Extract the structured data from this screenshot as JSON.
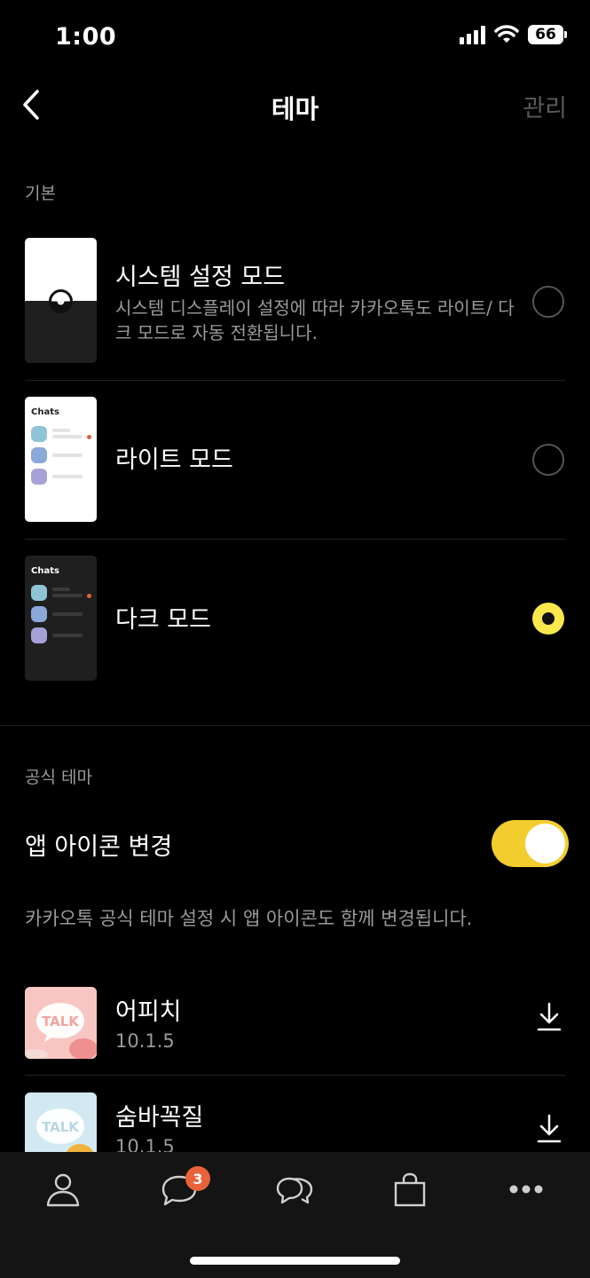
{
  "status": {
    "time": "1:00",
    "battery": "66"
  },
  "header": {
    "title": "테마",
    "manage": "관리"
  },
  "sections": {
    "basic": "기본",
    "official": "공식 테마"
  },
  "modes": [
    {
      "title": "시스템 설정 모드",
      "desc": "시스템 디스플레이 설정에 따라 카카오톡도 라이트/ 다크 모드로 자동 전환됩니다.",
      "selected": false
    },
    {
      "title": "라이트 모드",
      "thumb_label": "Chats",
      "selected": false
    },
    {
      "title": "다크 모드",
      "thumb_label": "Chats",
      "selected": true
    }
  ],
  "app_icon": {
    "label": "앱 아이콘 변경",
    "enabled": true,
    "note": "카카오톡 공식 테마 설정 시 앱 아이콘도 함께 변경됩니다."
  },
  "themes": [
    {
      "name": "어피치",
      "version": "10.1.5",
      "icon_text": "TALK"
    },
    {
      "name": "숨바꼭질",
      "version": "10.1.5",
      "icon_text": "TALK"
    }
  ],
  "tabbar": {
    "chat_badge": "3"
  },
  "colors": {
    "accent": "#fae84c",
    "toggle": "#f2cd2e",
    "badge": "#e8633a"
  }
}
